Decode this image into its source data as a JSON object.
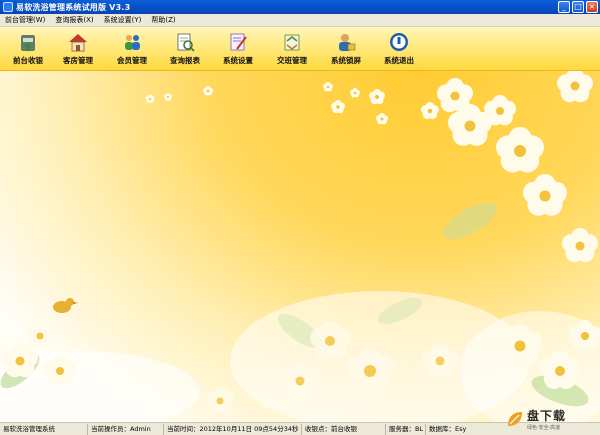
{
  "window": {
    "title": "易软洗浴管理系统试用版 V3.3",
    "buttons": {
      "minimize": "_",
      "maximize": "□",
      "close": "×"
    }
  },
  "menu": [
    {
      "label": "前台管理(W)"
    },
    {
      "label": "查询报表(X)"
    },
    {
      "label": "系统设置(Y)"
    },
    {
      "label": "帮助(Z)"
    }
  ],
  "toolbar": [
    {
      "label": "前台收银",
      "icon": "cash-register-icon",
      "color": "#2e8b3a"
    },
    {
      "label": "客房管理",
      "icon": "house-icon",
      "color": "#c0392b"
    },
    {
      "label": "会员管理",
      "icon": "members-icon",
      "color": "#2b6cc4"
    },
    {
      "label": "查询报表",
      "icon": "report-search-icon",
      "color": "#3a7a3a"
    },
    {
      "label": "系统设置",
      "icon": "settings-document-icon",
      "color": "#7a5ca8"
    },
    {
      "label": "交班管理",
      "icon": "shift-handover-icon",
      "color": "#5a8a2a"
    },
    {
      "label": "系统锁屏",
      "icon": "user-lock-icon",
      "color": "#2d6fb5"
    },
    {
      "label": "系统退出",
      "icon": "power-exit-icon",
      "color": "#1f5faa"
    }
  ],
  "status": {
    "system": "易软洗浴管理系统",
    "operator": "当前操作员：Admin",
    "time": "当前时间：2012年10月11日 09点54分34秒",
    "cashier_point": "收银点：前台收银",
    "server": "服务器：BL",
    "database": "数据库：Esy"
  },
  "watermark": {
    "main": "盘下载",
    "sub": "绿色·安全·高速"
  },
  "colors": {
    "titlebar": "#0a5fd8",
    "toolbar": "#ffd93e",
    "menubar": "#ece9d8"
  }
}
